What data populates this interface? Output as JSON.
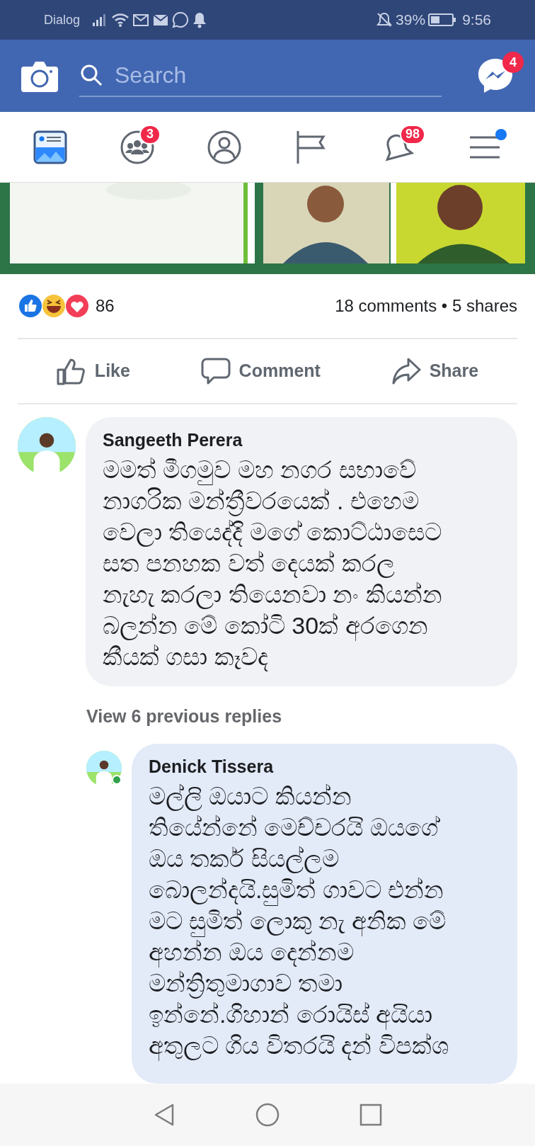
{
  "status_bar": {
    "carrier": "Dialog",
    "battery": "39%",
    "time": "9:56"
  },
  "header": {
    "search": {
      "placeholder": "Search"
    },
    "messenger_badge": "4"
  },
  "nav_tabs": [
    {
      "kind": "feed",
      "selected": true,
      "dot": false
    },
    {
      "kind": "groups",
      "selected": false,
      "badge": "3",
      "dot": false
    },
    {
      "kind": "profile",
      "selected": false,
      "dot": false
    },
    {
      "kind": "pages",
      "selected": false,
      "dot": false
    },
    {
      "kind": "notifications",
      "selected": false,
      "badge": "98",
      "dot": false
    },
    {
      "kind": "menu",
      "selected": false,
      "dot": true
    }
  ],
  "post": {
    "reaction_count": "86",
    "stats": "18 comments • 5 shares",
    "actions": [
      {
        "kind": "like",
        "label": "Like"
      },
      {
        "kind": "comment",
        "label": "Comment"
      },
      {
        "kind": "share",
        "label": "Share"
      }
    ]
  },
  "comments": [
    {
      "author": "Sangeeth Perera",
      "highlighted": false,
      "text": "මමත් මීගමුව මහ නගර සභාවේ\nනාගරික මන්ත්‍රීවරයෙක් . එහෙම\nවෙලා තියෙද්දි මගේ කොට්ඨාසෙට\nසත පනහක වත් දෙයක් කරල\nනැහැ  කරලා තියෙනවා නං කියන්න\nබලන්න මේ කෝටි 30ක් අරගෙන\nකීයක් ගසා කෑවද",
      "replies_link": "View 6 previous replies",
      "replies": [
        {
          "author": "Denick Tissera",
          "highlighted": true,
          "online": true,
          "text": "මල්ලි ඔයාට කියන්න\nතියේන්නේ මෙච්චරයි ඔයගේ\nඔය තර්ක සියල්ලම\nබොලන්දයි.සුමිත් ගාවට එන්න\nමට සුමිත්  ලොකු නැ අනික මේ\nඅහන්න ඔය දෙන්නම\nමන්ත්‍රිතුමාගාව  තමා\nඉන්නේ.ගිහාන් රොයිස් අයියා\nඅතුලට ගිය විතරයි දන් විපක්ශ"
        }
      ]
    }
  ]
}
